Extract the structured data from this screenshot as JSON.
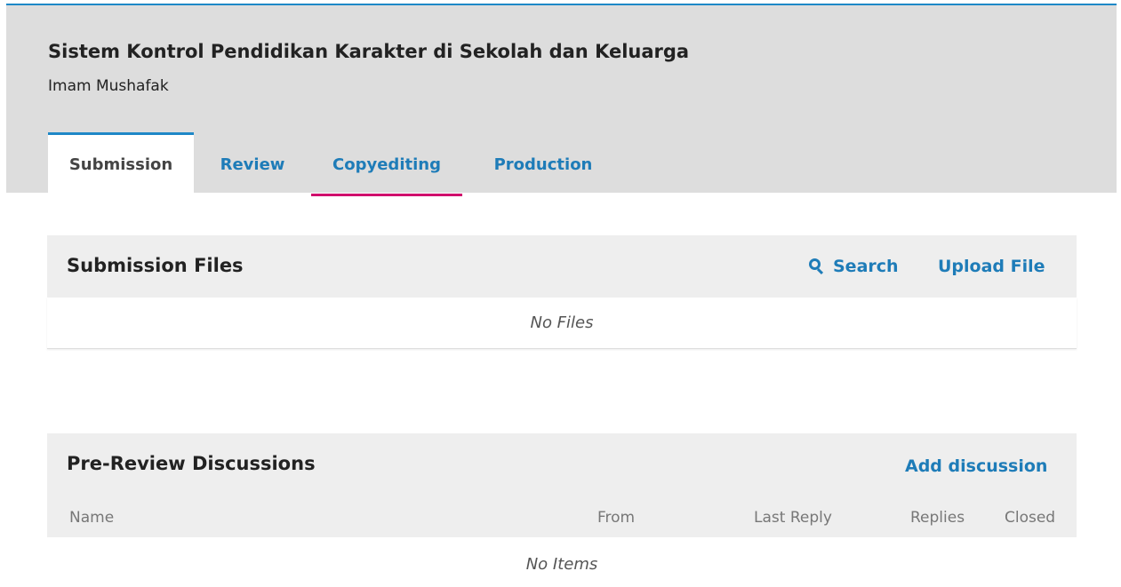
{
  "submission": {
    "title": "Sistem Kontrol Pendidikan Karakter di Sekolah dan Keluarga",
    "author": "Imam Mushafak"
  },
  "tabs": [
    {
      "label": "Submission",
      "active": true
    },
    {
      "label": "Review",
      "active": false
    },
    {
      "label": "Copyediting",
      "active": false
    },
    {
      "label": "Production",
      "active": false
    }
  ],
  "files_panel": {
    "title": "Submission Files",
    "search_label": "Search",
    "search_icon": "search-icon",
    "upload_label": "Upload File",
    "empty_text": "No Files"
  },
  "discussions_panel": {
    "title": "Pre-Review Discussions",
    "add_label": "Add discussion",
    "columns": [
      "Name",
      "From",
      "Last Reply",
      "Replies",
      "Closed"
    ],
    "empty_text": "No Items"
  },
  "colors": {
    "accent": "#1e7cb8",
    "tab_hover_underline": "#d00a6c",
    "header_bg": "#dddddd",
    "panel_header_bg": "#eeeeee"
  }
}
